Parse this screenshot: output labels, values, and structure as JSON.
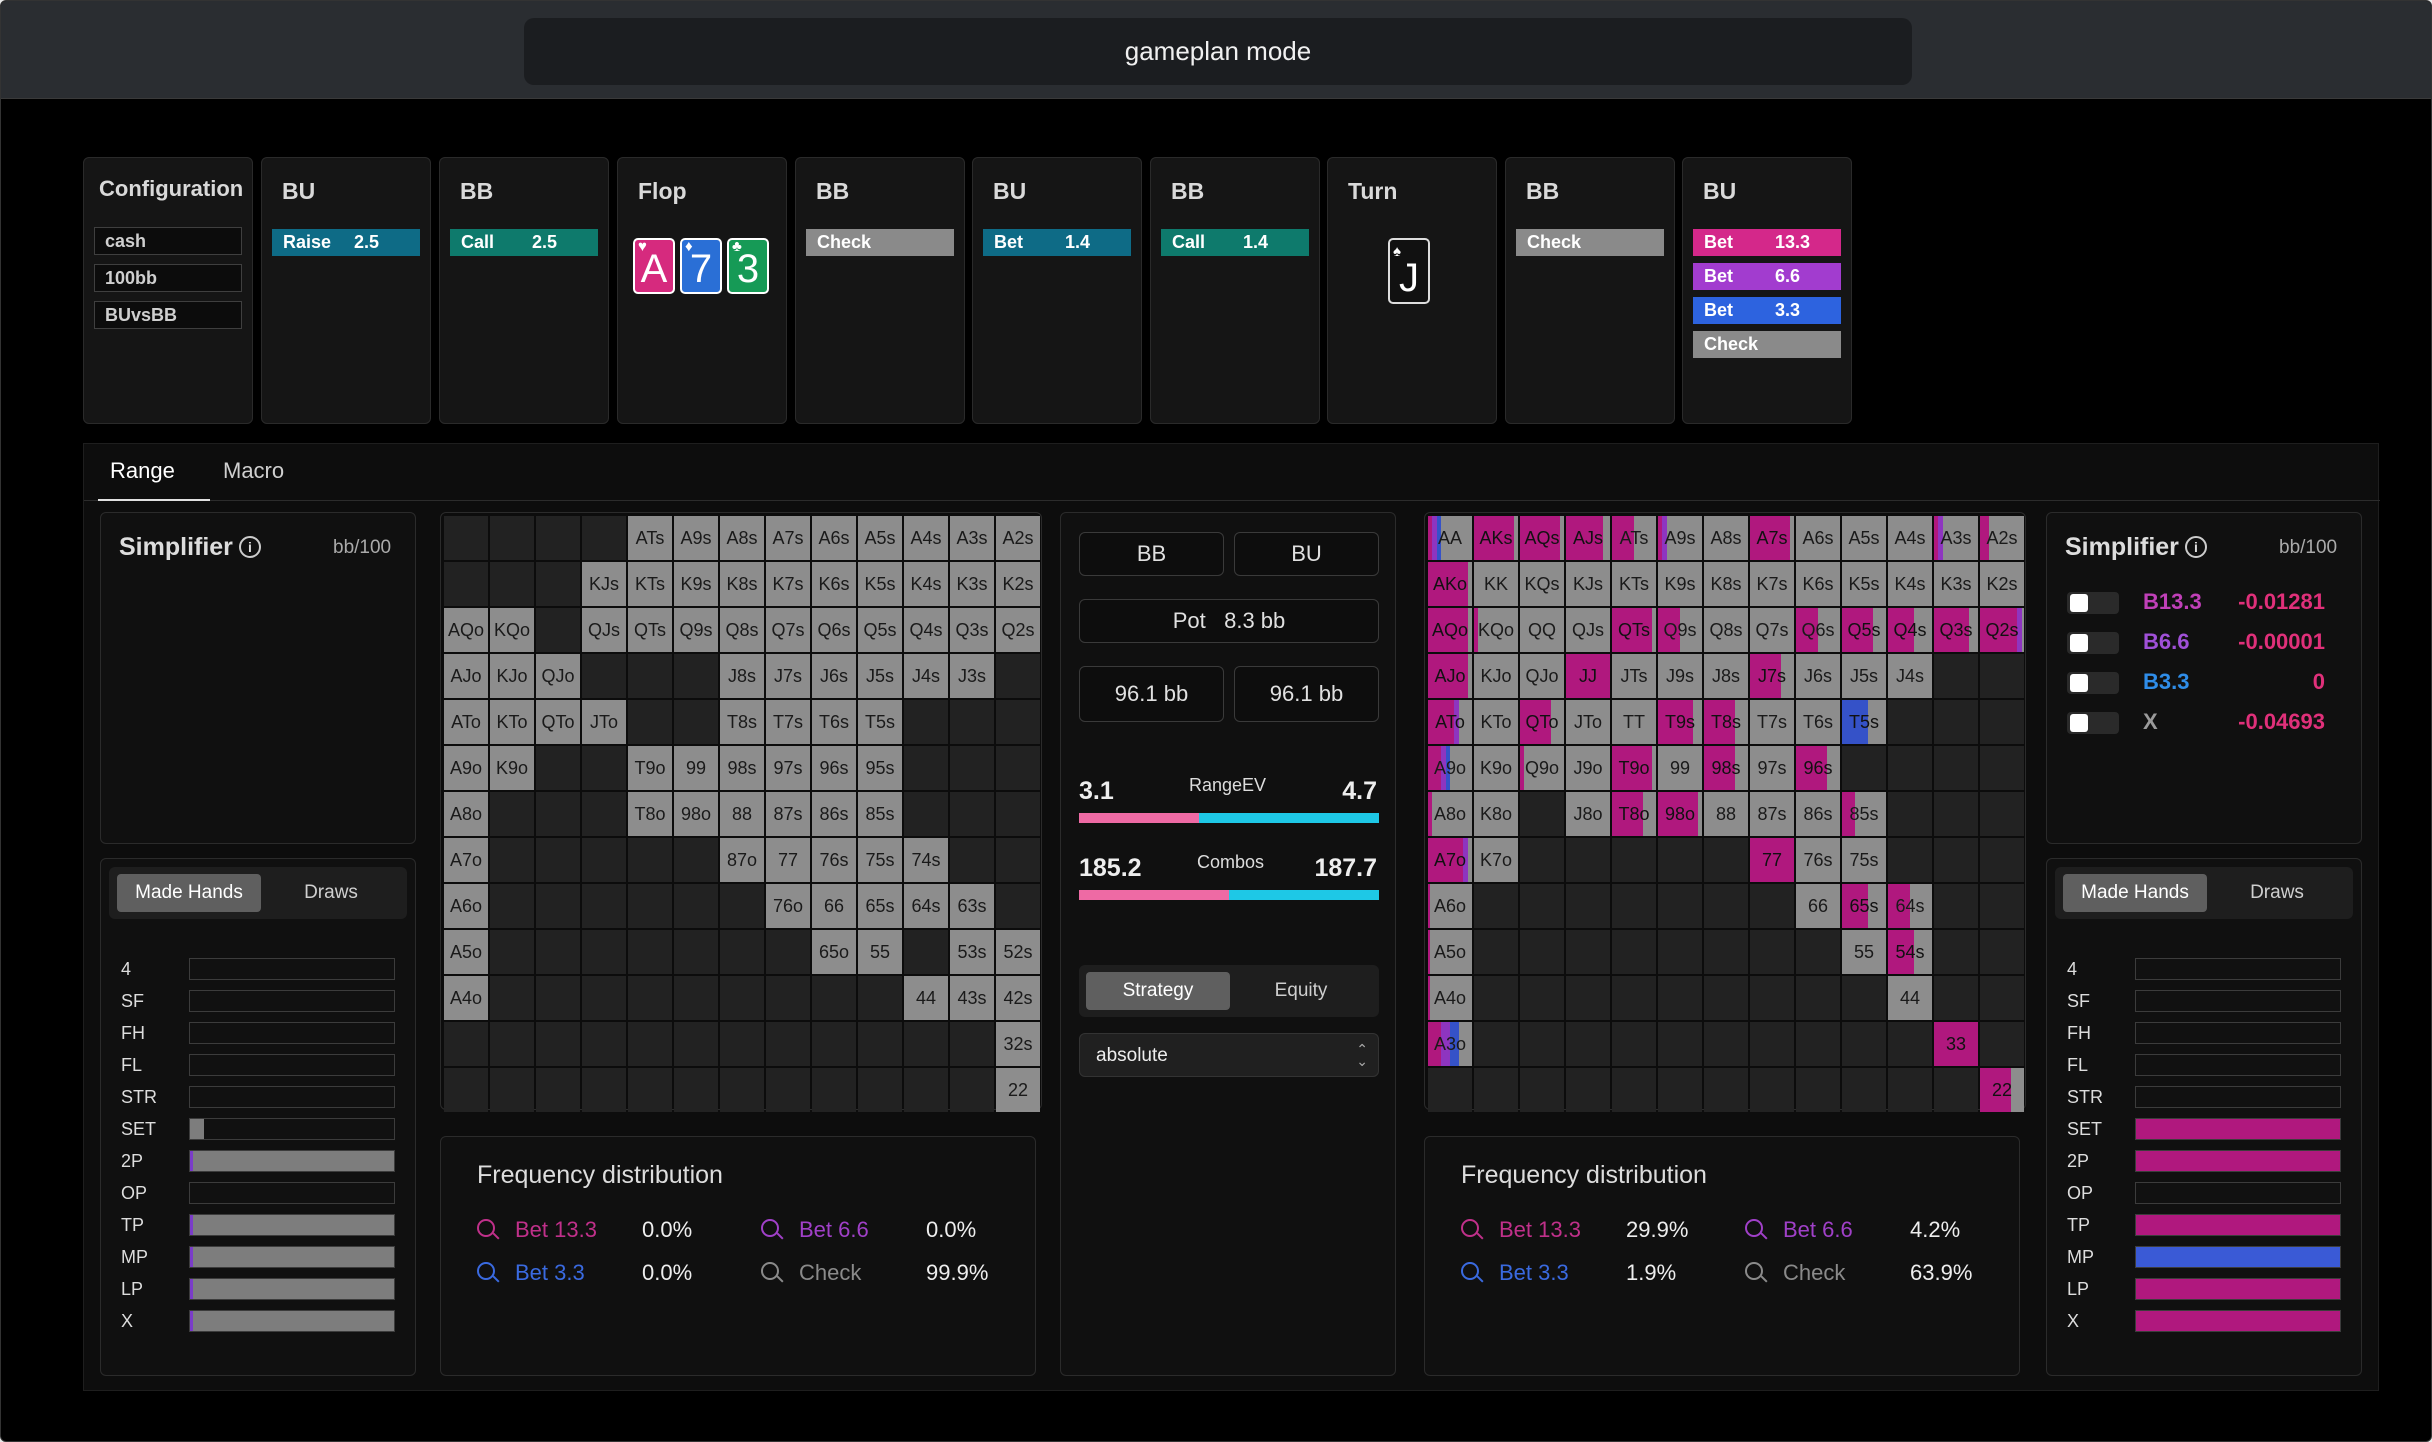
{
  "title": "gameplan mode",
  "config": {
    "label": "Configuration",
    "items": [
      "cash",
      "100bb",
      "BUvsBB"
    ]
  },
  "steps": [
    {
      "label": "BU",
      "actions": [
        {
          "a": "Raise",
          "v": "2.5",
          "c": "#0e6b86"
        }
      ]
    },
    {
      "label": "BB",
      "actions": [
        {
          "a": "Call",
          "v": "2.5",
          "c": "#0e7a6c"
        }
      ]
    },
    {
      "label": "Flop",
      "cards": [
        {
          "r": "A",
          "s": "♥",
          "c": "#d62a7e"
        },
        {
          "r": "7",
          "s": "♦",
          "c": "#2a6fd6"
        },
        {
          "r": "3",
          "s": "♣",
          "c": "#169a56"
        }
      ]
    },
    {
      "label": "BB",
      "actions": [
        {
          "a": "Check",
          "v": "",
          "c": "#8a8a8a"
        }
      ]
    },
    {
      "label": "BU",
      "actions": [
        {
          "a": "Bet",
          "v": "1.4",
          "c": "#0e6b86"
        }
      ]
    },
    {
      "label": "BB",
      "actions": [
        {
          "a": "Call",
          "v": "1.4",
          "c": "#0e7a6c"
        }
      ]
    },
    {
      "label": "Turn",
      "cards": [
        {
          "r": "J",
          "s": "♠",
          "c": "#111"
        }
      ]
    },
    {
      "label": "BB",
      "actions": [
        {
          "a": "Check",
          "v": "",
          "c": "#8a8a8a"
        }
      ]
    },
    {
      "label": "BU",
      "actions": [
        {
          "a": "Bet",
          "v": "13.3",
          "c": "#d4288a"
        },
        {
          "a": "Bet",
          "v": "6.6",
          "c": "#a23ccf"
        },
        {
          "a": "Bet",
          "v": "3.3",
          "c": "#2d63df"
        },
        {
          "a": "Check",
          "v": "",
          "c": "#8a8a8a"
        }
      ]
    }
  ],
  "tabs": {
    "range": "Range",
    "macro": "Macro"
  },
  "left_simplifier": {
    "title": "Simplifier",
    "unit": "bb/100"
  },
  "right_simplifier": {
    "title": "Simplifier",
    "unit": "bb/100",
    "rows": [
      {
        "name": "B13.3",
        "value": "-0.01281",
        "nc": "#c040b8",
        "vc": "#e0307a"
      },
      {
        "name": "B6.6",
        "value": "-0.00001",
        "nc": "#a050d8",
        "vc": "#e0307a"
      },
      {
        "name": "B3.3",
        "value": "0",
        "nc": "#2f8de8",
        "vc": "#e0307a"
      },
      {
        "name": "X",
        "value": "-0.04693",
        "nc": "#9a9a9a",
        "vc": "#e0307a"
      }
    ]
  },
  "made_hands": {
    "tab1": "Made Hands",
    "tab2": "Draws",
    "labels": [
      "4",
      "SF",
      "FH",
      "FL",
      "STR",
      "SET",
      "2P",
      "OP",
      "TP",
      "MP",
      "LP",
      "X"
    ],
    "left": [
      0,
      0,
      0,
      0,
      0,
      0.07,
      1,
      0,
      1,
      1,
      1,
      1
    ],
    "right": [
      0,
      0,
      0,
      0,
      0,
      1,
      1,
      0,
      1,
      1,
      1,
      1
    ]
  },
  "center": {
    "player_bb": "BB",
    "player_bu": "BU",
    "pot_label": "Pot",
    "pot_value": "8.3 bb",
    "stack_bb": "96.1 bb",
    "stack_bu": "96.1 bb",
    "rangeev_label": "RangeEV",
    "rangeev_bb": "3.1",
    "rangeev_bu": "4.7",
    "rangeev_share": 0.4,
    "combos_label": "Combos",
    "combos_bb": "185.2",
    "combos_bu": "187.7",
    "combos_share": 0.5,
    "view_strategy": "Strategy",
    "view_equity": "Equity",
    "select_value": "absolute"
  },
  "freq_left": {
    "title": "Frequency distribution",
    "items": [
      {
        "label": "Bet 13.3",
        "value": "0.0%",
        "c": "#c0308a"
      },
      {
        "label": "Bet 6.6",
        "value": "0.0%",
        "c": "#a040c8"
      },
      {
        "label": "Bet 3.3",
        "value": "0.0%",
        "c": "#3a6ae0"
      },
      {
        "label": "Check",
        "value": "99.9%",
        "c": "#8a8a8a"
      }
    ]
  },
  "freq_right": {
    "title": "Frequency distribution",
    "items": [
      {
        "label": "Bet 13.3",
        "value": "29.9%",
        "c": "#c0308a"
      },
      {
        "label": "Bet 6.6",
        "value": "4.2%",
        "c": "#a040c8"
      },
      {
        "label": "Bet 3.3",
        "value": "1.9%",
        "c": "#3a6ae0"
      },
      {
        "label": "Check",
        "value": "63.9%",
        "c": "#8a8a8a"
      }
    ]
  },
  "colors": {
    "b13": "#b0187e",
    "b66": "#8e35c0",
    "b33": "#3552c8",
    "check": "#8d8d8d",
    "empty": "#222222"
  },
  "bb_range": [
    "A3s",
    "A4s",
    "A5s",
    "A6s",
    "A7s",
    "A8s",
    "A9s",
    "ATs",
    "AQo",
    "AJo",
    "ATo",
    "A9o",
    "A8o",
    "A7o",
    "A6o",
    "A5o",
    "A4o",
    "KJs",
    "KTs",
    "K9s",
    "K8s",
    "K7s",
    "K6s",
    "K5s",
    "K4s",
    "K3s",
    "K2s",
    "KQo",
    "KJo",
    "KTo",
    "K9o",
    "QJs",
    "QTs",
    "Q9s",
    "Q8s",
    "Q7s",
    "Q6s",
    "Q5s",
    "Q4s",
    "Q3s",
    "Q2s",
    "QJo",
    "QTo",
    "J8s",
    "J7s",
    "J6s",
    "J5s",
    "J4s",
    "J3s",
    "JTo",
    "T8s",
    "T7s",
    "T6s",
    "T5s",
    "99",
    "98s",
    "97s",
    "96s",
    "95s",
    "T9o",
    "88",
    "87s",
    "86s",
    "85s",
    "T8o",
    "98o",
    "77",
    "76s",
    "75s",
    "74s",
    "87o",
    "66",
    "65s",
    "64s",
    "63s",
    "76o",
    "55",
    "53s",
    "52s",
    "65o",
    "44",
    "43s",
    "42s",
    "32s",
    "22",
    "A2s"
  ],
  "bu_range": [
    "AA",
    "AKs",
    "AQs",
    "AJs",
    "ATs",
    "A9s",
    "A8s",
    "A7s",
    "A6s",
    "A5s",
    "A4s",
    "A3s",
    "A2s",
    "AKo",
    "KK",
    "KQs",
    "KJs",
    "KTs",
    "K9s",
    "K8s",
    "K7s",
    "K6s",
    "K5s",
    "K4s",
    "K3s",
    "K2s",
    "AQo",
    "KQo",
    "QQ",
    "QJs",
    "QTs",
    "Q9s",
    "Q8s",
    "Q7s",
    "Q6s",
    "Q5s",
    "Q4s",
    "Q3s",
    "Q2s",
    "AJo",
    "KJo",
    "QJo",
    "JJ",
    "JTs",
    "J9s",
    "J8s",
    "J7s",
    "J6s",
    "J5s",
    "J4s",
    "ATo",
    "KTo",
    "QTo",
    "JTo",
    "TT",
    "T9s",
    "T8s",
    "T7s",
    "T6s",
    "T5s",
    "A9o",
    "K9o",
    "Q9o",
    "J9o",
    "T9o",
    "99",
    "98s",
    "97s",
    "96s",
    "A8o",
    "K8o",
    "J8o",
    "T8o",
    "98o",
    "88",
    "87s",
    "86s",
    "85s",
    "A7o",
    "K7o",
    "77",
    "76s",
    "75s",
    "A6o",
    "66",
    "65s",
    "64s",
    "A5o",
    "55",
    "54s",
    "A4o",
    "44",
    "A3o",
    "33",
    "22"
  ],
  "bu_mix": {
    "AA": [
      0.1,
      0.1,
      0.1,
      0.7
    ],
    "AKs": [
      0.9,
      0,
      0,
      0.1
    ],
    "AQs": [
      0.9,
      0,
      0,
      0.1
    ],
    "AJs": [
      0.85,
      0,
      0,
      0.15
    ],
    "ATs": [
      0.5,
      0,
      0,
      0.5
    ],
    "A9s": [
      0.1,
      0.1,
      0,
      0.8
    ],
    "A7s": [
      0.9,
      0,
      0,
      0.1
    ],
    "A3s": [
      0.1,
      0.1,
      0,
      0.8
    ],
    "A2s": [
      0.2,
      0,
      0,
      0.8
    ],
    "AKo": [
      0.9,
      0,
      0,
      0.1
    ],
    "AQo": [
      0.9,
      0,
      0,
      0.1
    ],
    "AJo": [
      0.9,
      0,
      0,
      0.1
    ],
    "ATo": [
      0.6,
      0.1,
      0,
      0.3
    ],
    "A9o": [
      0.3,
      0.1,
      0.1,
      0.5
    ],
    "A8o": [
      0.1,
      0,
      0,
      0.9
    ],
    "A7o": [
      0.8,
      0.1,
      0,
      0.1
    ],
    "A6o": [
      0.05,
      0,
      0,
      0.95
    ],
    "A5o": [
      0.05,
      0,
      0,
      0.95
    ],
    "A4o": [
      0.05,
      0,
      0,
      0.95
    ],
    "A3o": [
      0.3,
      0.2,
      0.2,
      0.3
    ],
    "KQo": [
      0.1,
      0,
      0,
      0.9
    ],
    "QTs": [
      0.9,
      0,
      0,
      0.1
    ],
    "Q9s": [
      0.5,
      0,
      0,
      0.5
    ],
    "Q6s": [
      0.5,
      0,
      0,
      0.5
    ],
    "Q5s": [
      0.7,
      0,
      0,
      0.3
    ],
    "Q4s": [
      0.6,
      0,
      0,
      0.4
    ],
    "Q3s": [
      0.8,
      0,
      0,
      0.2
    ],
    "Q2s": [
      0.85,
      0.1,
      0,
      0.05
    ],
    "QTo": [
      0.7,
      0,
      0,
      0.3
    ],
    "Q9o": [
      0.1,
      0,
      0,
      0.9
    ],
    "JJ": [
      1,
      0,
      0,
      0
    ],
    "J7s": [
      0.7,
      0,
      0,
      0.3
    ],
    "T9s": [
      0.8,
      0,
      0,
      0.2
    ],
    "T8s": [
      0.7,
      0,
      0,
      0.3
    ],
    "T5s": [
      0,
      0,
      0.6,
      0.4
    ],
    "T9o": [
      0.9,
      0,
      0,
      0.1
    ],
    "T8o": [
      0.7,
      0,
      0,
      0.3
    ],
    "98o": [
      0.9,
      0,
      0,
      0.1
    ],
    "98s": [
      0.7,
      0,
      0,
      0.3
    ],
    "96s": [
      0.7,
      0,
      0,
      0.3
    ],
    "85s": [
      0.3,
      0,
      0,
      0.7
    ],
    "77": [
      1,
      0,
      0,
      0
    ],
    "65s": [
      0.6,
      0,
      0,
      0.4
    ],
    "64s": [
      0.5,
      0,
      0,
      0.5
    ],
    "54s": [
      0.6,
      0,
      0,
      0.4
    ],
    "33": [
      1,
      0,
      0,
      0
    ],
    "22": [
      0.7,
      0,
      0,
      0.3
    ]
  }
}
